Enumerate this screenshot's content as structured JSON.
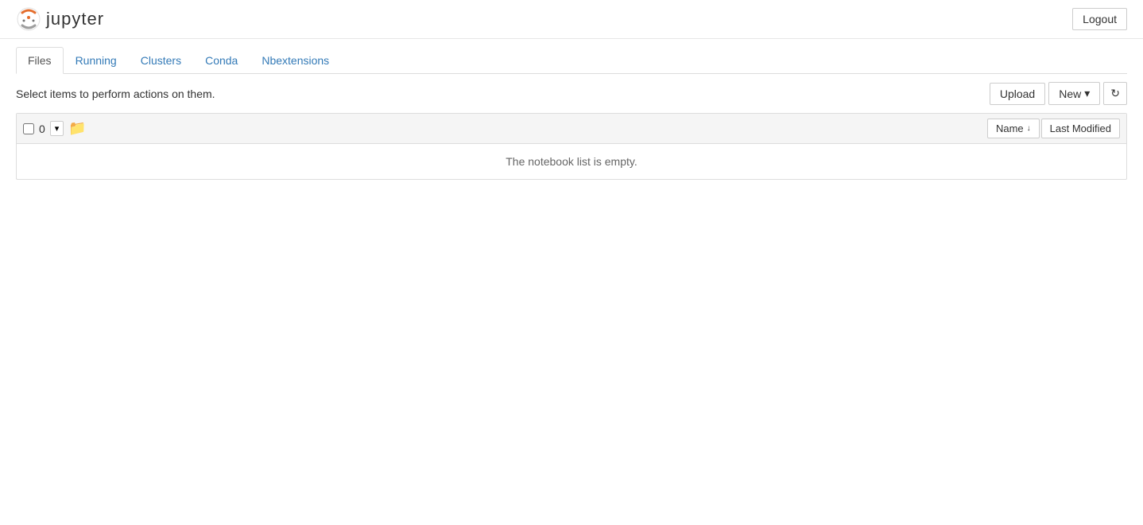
{
  "header": {
    "logo_text": "jupyter",
    "logout_label": "Logout"
  },
  "tabs": [
    {
      "id": "files",
      "label": "Files",
      "active": true
    },
    {
      "id": "running",
      "label": "Running",
      "active": false
    },
    {
      "id": "clusters",
      "label": "Clusters",
      "active": false
    },
    {
      "id": "conda",
      "label": "Conda",
      "active": false
    },
    {
      "id": "nbextensions",
      "label": "Nbextensions",
      "active": false
    }
  ],
  "toolbar": {
    "select_message": "Select items to perform actions on them.",
    "upload_label": "Upload",
    "new_label": "New",
    "new_arrow": "▾",
    "refresh_icon": "↻"
  },
  "file_list": {
    "select_count": "0",
    "dropdown_arrow": "▾",
    "folder_icon": "📁",
    "name_label": "Name",
    "sort_arrow": "↓",
    "last_modified_label": "Last Modified",
    "empty_message": "The notebook list is empty."
  }
}
